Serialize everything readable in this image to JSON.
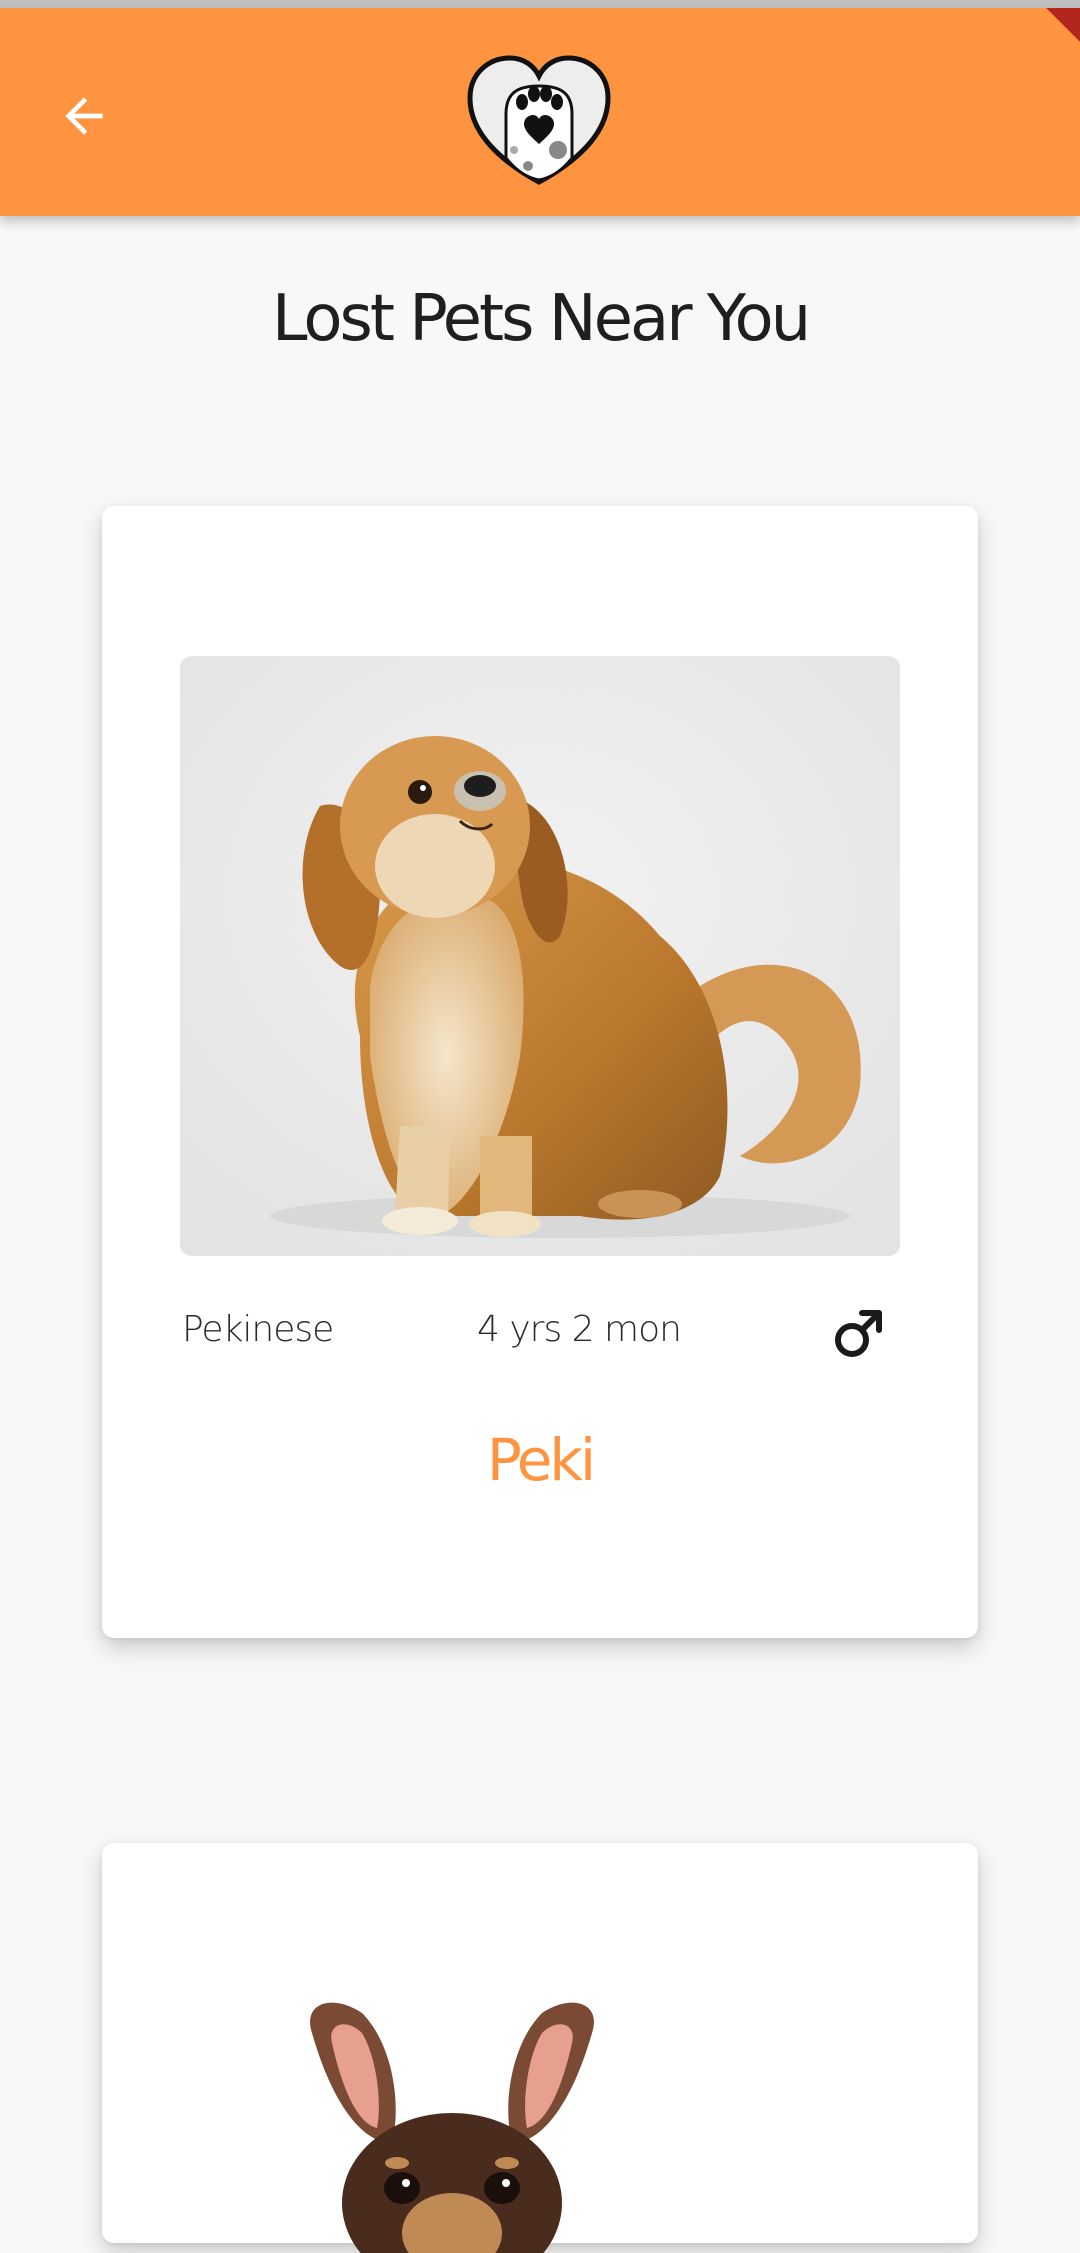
{
  "app_bar": {
    "back_icon": "arrow-left-icon",
    "logo_icon": "heart-paw-logo",
    "background_color": "#fe9440"
  },
  "page": {
    "title": "Lost Pets Near You"
  },
  "pets": [
    {
      "photo": "pekinese-dog-photo",
      "breed": "Pekinese",
      "age": "4 yrs  2 mon",
      "gender_icon": "male-icon",
      "name": "Peki"
    },
    {
      "photo": "chihuahua-dog-photo"
    }
  ],
  "colors": {
    "accent": "#fe9440",
    "title_text": "#1f1f1f",
    "background": "#f8f8f8"
  }
}
